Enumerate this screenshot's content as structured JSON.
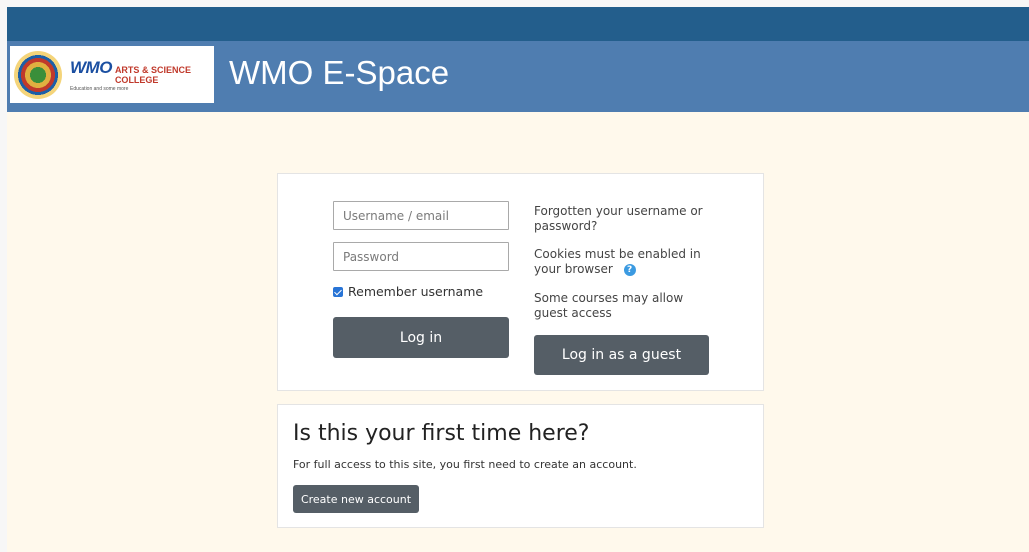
{
  "header": {
    "site_title": "WMO E-Space",
    "logo": {
      "brand": "WMO",
      "college": "ARTS & SCIENCE COLLEGE",
      "tagline": "Education and some more"
    }
  },
  "login": {
    "username_placeholder": "Username / email",
    "password_placeholder": "Password",
    "remember_label": "Remember username",
    "remember_checked": true,
    "login_button": "Log in",
    "forgot_link": "Forgotten your username or password?",
    "cookies_note": "Cookies must be enabled in your browser",
    "guest_note": "Some courses may allow guest access",
    "guest_button": "Log in as a guest"
  },
  "signup": {
    "title": "Is this your first time here?",
    "text": "For full access to this site, you first need to create an account.",
    "button": "Create new account"
  },
  "colors": {
    "topbar": "#235e8c",
    "banner": "#4f7db0",
    "content_bg": "#fff9ec",
    "button": "#555e66",
    "help_icon": "#3b9ae1"
  },
  "icons": {
    "help": "question-circle-icon",
    "checkbox": "checkbox-checked-icon",
    "logo": "college-seal-icon"
  }
}
